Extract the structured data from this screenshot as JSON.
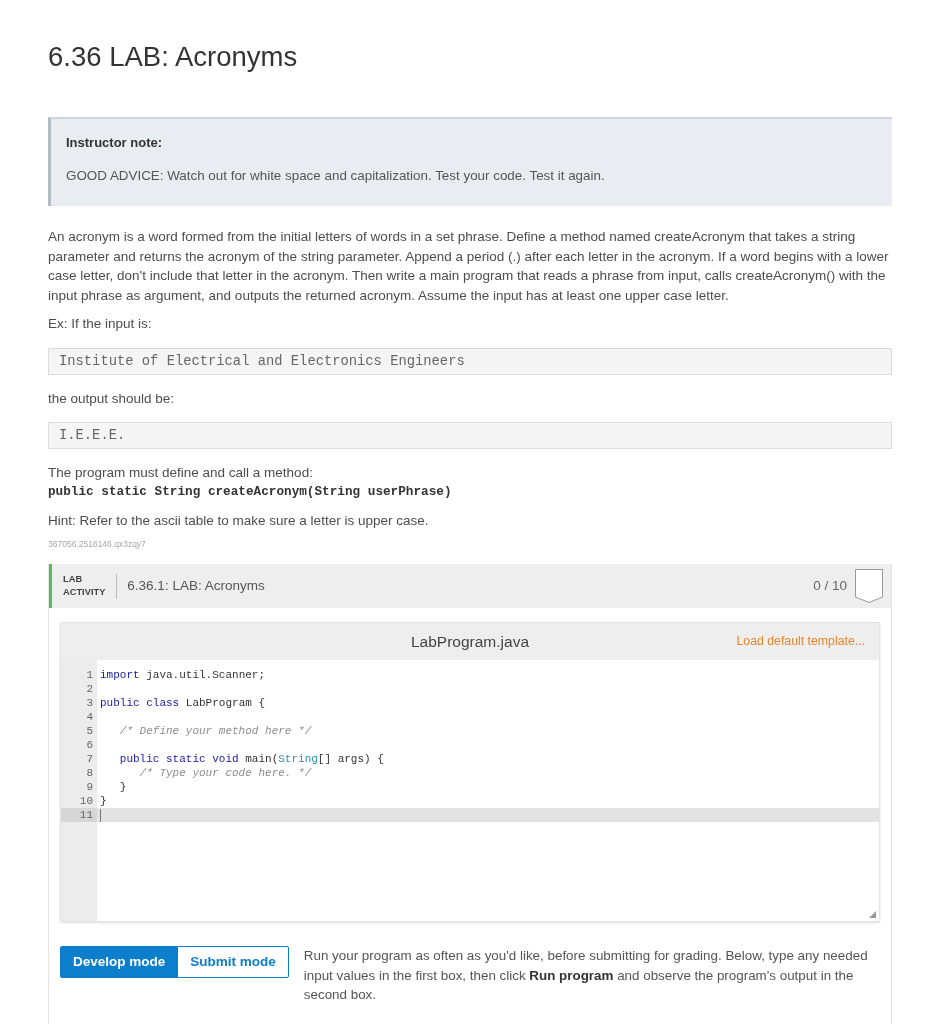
{
  "title": "6.36 LAB: Acronyms",
  "instructor_note": {
    "heading": "Instructor note:",
    "text": "GOOD ADVICE: Watch out for white space and capitalization. Test your code. Test it again."
  },
  "content": [
    {
      "kind": "paragraph",
      "text": "An acronym is a word formed from the initial letters of words in a set phrase. Define a method named createAcronym that takes a string parameter and returns the acronym of the string parameter. Append a period (.) after each letter in the acronym. If a word begins with a lower case letter, don't include that letter in the acronym. Then write a main program that reads a phrase from input, calls createAcronym() with the input phrase as argument, and outputs the returned acronym. Assume the input has at least one upper case letter."
    },
    {
      "kind": "paragraph",
      "text": "Ex: If the input is:"
    },
    {
      "kind": "sample",
      "text": "Institute of Electrical and Electronics Engineers"
    },
    {
      "kind": "paragraph",
      "text": "the output should be:"
    },
    {
      "kind": "sample",
      "text": "I.E.E.E."
    },
    {
      "kind": "lead_in",
      "text": "The program must define and call a method:"
    },
    {
      "kind": "signature",
      "text": "public static String createAcronym(String userPhrase)"
    },
    {
      "kind": "hint",
      "text": "Hint: Refer to the ascii table to make sure a letter is upper case."
    },
    {
      "kind": "id",
      "text": "367056.2516146.qx3zqy7"
    }
  ],
  "lab_activity": {
    "label": "LAB ACTIVITY",
    "title": "6.36.1: LAB: Acronyms",
    "score": "0 / 10",
    "editor": {
      "filename": "LabProgram.java",
      "load_template": "Load default template...",
      "lines": [
        {
          "number": "1",
          "selected": false,
          "tokens": [
            {
              "kind": "keyword",
              "text": "import"
            },
            {
              "kind": "plain",
              "text": " java.util.Scanner;"
            }
          ]
        },
        {
          "number": "2",
          "selected": false
        },
        {
          "number": "3",
          "selected": false,
          "tokens": [
            {
              "kind": "keyword",
              "text": "public class"
            },
            {
              "kind": "plain",
              "text": " LabProgram {"
            }
          ]
        },
        {
          "number": "4",
          "selected": false
        },
        {
          "number": "5",
          "selected": false,
          "tokens": [
            {
              "kind": "comment",
              "text": "   /* Define your method here */"
            }
          ]
        },
        {
          "number": "6",
          "selected": false
        },
        {
          "number": "7",
          "selected": false,
          "tokens": [
            {
              "kind": "keyword",
              "text": "   public static void"
            },
            {
              "kind": "plain",
              "text": " main("
            },
            {
              "kind": "type",
              "text": "String"
            },
            {
              "kind": "plain",
              "text": "[] args) {"
            }
          ]
        },
        {
          "number": "8",
          "selected": false,
          "tokens": [
            {
              "kind": "comment",
              "text": "      /* Type your code here. */"
            }
          ]
        },
        {
          "number": "9",
          "selected": false,
          "tokens": [
            {
              "kind": "plain",
              "text": "   }"
            }
          ]
        },
        {
          "number": "10",
          "selected": false,
          "tokens": [
            {
              "kind": "plain",
              "text": "}"
            }
          ]
        },
        {
          "number": "11",
          "selected": true
        }
      ]
    },
    "modes": [
      {
        "label": "Develop mode",
        "selected": true
      },
      {
        "label": "Submit mode",
        "selected": false
      }
    ],
    "mode_description": "Run your program as often as you'd like, before submitting for grading. Below, type any needed input values in the first box, then click **Run program** and observe the program's output in the second box."
  }
}
